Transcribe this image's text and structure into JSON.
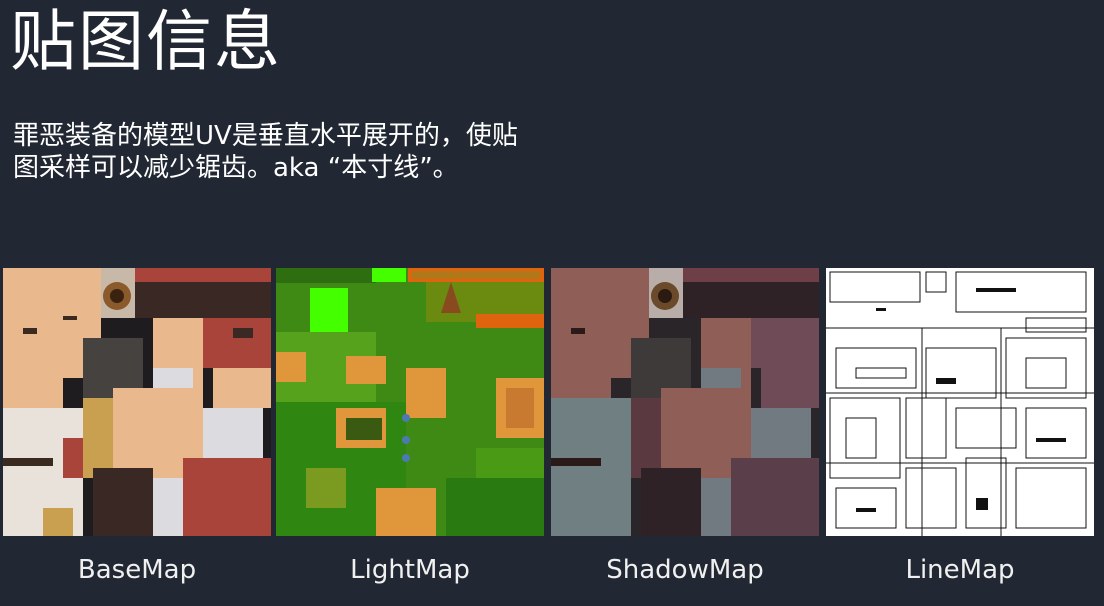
{
  "slide": {
    "title": "贴图信息",
    "description_lines": [
      "罪恶装备的模型UV是垂直水平展开的，使贴",
      "图采样可以减少锯齿。aka “本寸线”。"
    ]
  },
  "maps": [
    {
      "label": "BaseMap",
      "icon": "base-texture-thumbnail"
    },
    {
      "label": "LightMap",
      "icon": "light-texture-thumbnail"
    },
    {
      "label": "ShadowMap",
      "icon": "shadow-texture-thumbnail"
    },
    {
      "label": "LineMap",
      "icon": "line-texture-thumbnail"
    }
  ],
  "colors": {
    "background": "#222833",
    "text": "#ffffff"
  }
}
